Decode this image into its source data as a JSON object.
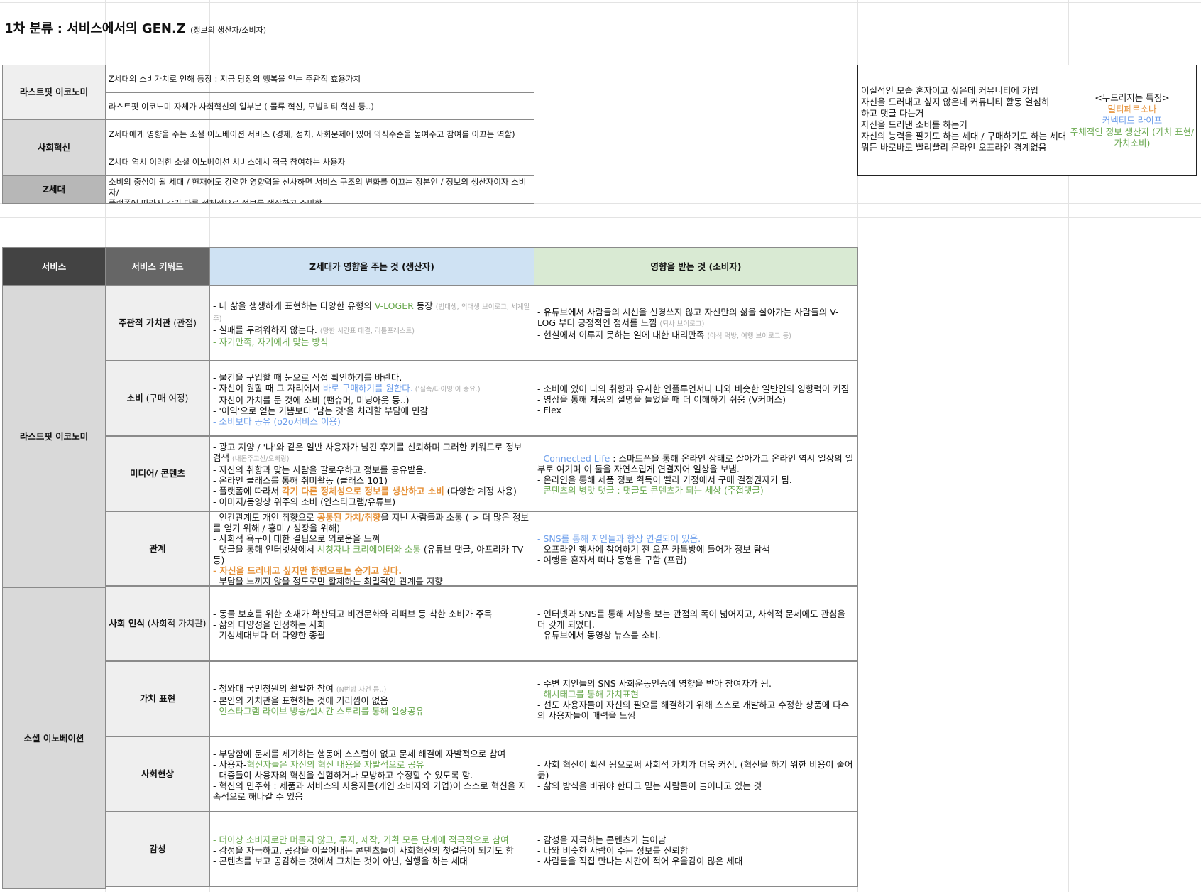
{
  "title": {
    "main": "1차 분류 : 서비스에서의 GEN.Z",
    "sub": "(정보의 생산자/소비자)"
  },
  "definitions": {
    "lastfit_label": "라스트핏 이코노미",
    "lastfit_1": "Z세대의 소비가치로 인해 등장 : 지금 당장의 행복을 얻는 주관적 효용가치",
    "lastfit_2": "라스트핏 이코노미 자체가 사회혁신의 일부분 ( 물류 혁신, 모빌리티 혁신 등..)",
    "social_label": "사회혁신",
    "social_1": "Z세대에게 영향을 주는 소셜 이노베이션 서비스 (경제, 정치, 사회문제에 있어 의식수준을 높여주고 참여를 이끄는 역할)",
    "social_2": "Z세대 역시 이러한 소셜 이노베이션 서비스에서 적극 참여하는 사용자",
    "genz_label": "Z세대",
    "genz_1": "소비의 중심이 될 세대 / 현재에도 강력한 영향력을 선사하면 서비스 구조의 변화를 이끄는 장본인 / 정보의 생산자이자 소비자/",
    "genz_2": "플랫폼에 따라서 각기 다른 정체성으로 정보를 생산하고 소비함."
  },
  "side_note": {
    "lines": [
      "이질적인 모습 혼자이고 싶은데 커뮤니티에 가입",
      "자신을 드러내고 싶지 않은데 커뮤니티 활동 열심히",
      "하고 댓글 다는거",
      "자신을 드러낸 소비를 하는거",
      "자신의 능력을 팔기도 하는 세대 / 구매하기도 하는 세대",
      "뭐든 바로바로 빨리빨리 온라인 오프라인 경계없음"
    ],
    "heading": "<두드러지는 특징>",
    "trait_1": "멀티페르소나",
    "trait_2": "커넥티드 라이프",
    "trait_3": "주체적인 정보 생산자 (가치 표현/가치소비)"
  },
  "table": {
    "headers": {
      "service": "서비스",
      "keyword": "서비스 키워드",
      "producer": "Z세대가 영향을 주는 것 (생산자)",
      "consumer": "영향을 받는 것 (소비자)"
    },
    "group_1": "라스트핏 이코노미",
    "group_2": "소셜 이노베이션",
    "rows": [
      {
        "kw_main": "주관적 가치관",
        "kw_sub": " (관점)",
        "p": [
          {
            "t": "- 내 삶을 생생하게 표현하는 다양한 유형의 ",
            "g": "V-LOGER",
            "t2": " 등장 ",
            "m": "(법대생, 의대생 브이로그, 세계일주)"
          },
          {
            "t": "- 실패를 두려워하지 않는다. ",
            "m": "(망한 시간표 대결, 리틀포레스트)"
          },
          {
            "g": "- 자기만족, 자기에게 맞는 방식"
          }
        ],
        "c": [
          {
            "t": "- 유튜브에서 사람들의 시선을 신경쓰지 않고 자신만의 삶을 살아가는 사람들의 V-LOG 부터 긍정적인 정서를 느낌 ",
            "m": "(퇴사 브이로그)"
          },
          {
            "t": "- 현실에서 이루지 못하는 일에 대한 대리만족 ",
            "m": "(야식 먹방, 여행 브이로그 등)"
          }
        ]
      },
      {
        "kw_main": "소비",
        "kw_sub": " (구매 여정)",
        "p": [
          {
            "t": "- 물건을 구입할 때 눈으로 직접 확인하기를 바란다."
          },
          {
            "t": "- 자신이 원할 때 그 자리에서 ",
            "b": "바로 구매하기를 원한다.",
            "m": " ('실속/타이밍'이 중요.)"
          },
          {
            "t": "- 자신이 가치를 둔 것에 소비 (팬슈머, 미닝아웃 등..)"
          },
          {
            "t": "- '이익'으로 얻는 기쁨보다 '남는 것'을 처리할 부담에 민감"
          },
          {
            "b": "- 소비보다 공유 (o2o서비스 이용)"
          }
        ],
        "c": [
          {
            "t": "- 소비에 있어 나의 취향과 유사한 인플루언서나 나와 비슷한 일반인의 영향력이 커짐"
          },
          {
            "t": "- 영상을 통해 제품의 설명을 들었을 때 더 이해하기 쉬움 (V커머스)"
          },
          {
            "t": "- Flex"
          }
        ]
      },
      {
        "kw_main": "미디어/ 콘텐츠",
        "kw_sub": "",
        "p": [
          {
            "t": "- 광고 지양 / '나'와 같은 일반 사용자가 남긴 후기를 신뢰하며 그러한 키워드로 정보 검색 ",
            "m": "(내돈주고산/오빠랑)"
          },
          {
            "t": "- 자신의 취향과 맞는 사람을 팔로우하고 정보를 공유받음."
          },
          {
            "t": "- 온라인 클래스를 통해 취미활동 (클래스 101)"
          },
          {
            "t": "- 플랫폼에 따라서 ",
            "o": "각기 다른 정체성으로 정보를 생산하고 소비",
            "t2": " (다양한 계정 사용)"
          },
          {
            "t": "- 이미지/동영상 위주의 소비 (인스타그램/유튜브)"
          }
        ],
        "c": [
          {
            "t": "- ",
            "b": "Connected Life",
            "t2": " : 스마트폰을 통해 온라인 상태로 살아가고 온라인 역시 일상의 일부로 여기며 이 둘을 자연스럽게 연결지어 일상을 보냄."
          },
          {
            "t": "- 온라인을 통해 제품 정보 획득이 빨라 가정에서 구매 결정권자가 됨."
          },
          {
            "g": "- 콘텐츠의 병맛 댓글 : 댓글도 콘텐츠가 되는 세상 (주접댓글)"
          }
        ]
      },
      {
        "kw_main": "관계",
        "kw_sub": "",
        "p": [
          {
            "t": "- 인간관계도 개인 취향으로 ",
            "o": "공통된 가치/취향",
            "t2": "을 지닌 사람들과 소통 (-> 더 많은 정보를 얻기 위해 / 흥미 / 성장을 위해)"
          },
          {
            "t": "- 사회적 욕구에 대한 결핍으로 외로움을 느껴"
          },
          {
            "t": "- 댓글을 통해 인터넷상에서 ",
            "g": "시청자나 크리에이터와 소통",
            "t2": " (유튜브 댓글, 아프리카 TV 등)"
          },
          {
            "o": "- 자신을 드러내고 싶지만 한편으로는 숨기고 싶다."
          },
          {
            "t": "- 부담을 느끼지 않을 정도로만 할제하는 최밀적인 관계를 지향"
          }
        ],
        "c": [
          {
            "b": "- SNS를 통해 지인들과 항상 연결되어 있음."
          },
          {
            "t": "- 오프라인 행사에 참여하기 전 오픈 카톡방에 들어가 정보 탐색"
          },
          {
            "t": "- 여행을 혼자서 떠나 동행을 구함 (프립)"
          }
        ]
      },
      {
        "kw_main": "사회 인식",
        "kw_sub": " (사회적 가치관)",
        "p": [
          {
            "t": "- 동물 보호를 위한 소재가 확산되고 비건문화와 리퍼브 등 착한 소비가 주목"
          },
          {
            "t": "- 삶의 다양성을 인정하는 사회"
          },
          {
            "t": "- 기성세대보다 더 다양한 종괄"
          }
        ],
        "c": [
          {
            "t": "- 인터넷과 SNS를 통해 세상을 보는 관점의 폭이 넓어지고, 사회적 문제에도 관심을 더 갖게 되었다."
          },
          {
            "t": "- 유튜브에서 동영상 뉴스를 소비."
          }
        ]
      },
      {
        "kw_main": "가치 표현",
        "kw_sub": "",
        "p": [
          {
            "t": "- 청와대 국민청원의 활발한 참여 ",
            "m": "(N번방 사건 등..)"
          },
          {
            "t": "- 본인의 가치관을 표현하는 것에 거리낌이 없음"
          },
          {
            "g": "- 인스타그램 라이브 방송/실시간 스토리를 통해 일상공유"
          }
        ],
        "c": [
          {
            "t": "- 주변 지인들의 SNS 사회운동인증에 영향을 받아 참여자가 됨."
          },
          {
            "g": "- 해시태그를 통해 가치표현"
          },
          {
            "t": "- 선도 사용자들이 자신의 필요를 해결하기 위해 스스로 개발하고 수정한 상품에 다수의 사용자들이 매력을 느낌"
          }
        ]
      },
      {
        "kw_main": "사회현상",
        "kw_sub": "",
        "p": [
          {
            "t": "- 부당함에 문제를 제기하는 행동에 스스럼이 없고 문제 해결에 자발적으로 참여"
          },
          {
            "t": "- 사용자-",
            "g": "혁신자들은 자신의 혁신 내용을 자발적으로 공유"
          },
          {
            "t": "- 대중들이 사용자의 혁신을 실험하거나 모방하고 수정할 수 있도록 함."
          },
          {
            "t": "- 혁신의 민주화 : 제품과 서비스의 사용자들(개인 소비자와 기업)이 스스로 혁신을 지속적으로 해나갈 수 있음"
          }
        ],
        "c": [
          {
            "t": "- 사회 혁신이 확산 됨으로써 사회적 가치가 더욱 커짐. (혁신을 하기 위한 비용이 줄어듦)"
          },
          {
            "t": "- 삶의 방식을 바꿔야 한다고 믿는 사람들이 늘어나고 있는 것"
          }
        ]
      },
      {
        "kw_main": "감성",
        "kw_sub": "",
        "p": [
          {
            "g": "- 더이상 소비자로만 머물지 않고, 투자, 제작, 기획 모든 단계에 적극적으로 참여"
          },
          {
            "t": "- 감성을 자극하고, 공감을 이끌어내는 콘텐츠들이 사회혁신의 첫걸음이 되기도 함"
          },
          {
            "t": "- 콘텐츠를 보고 공감하는 것에서 그치는 것이 아닌, 실행을 하는 세대"
          }
        ],
        "c": [
          {
            "t": "- 감성을 자극하는 콘텐츠가 늘어남"
          },
          {
            "t": "- 나와 비슷한 사람이 주는 정보를 신뢰함"
          },
          {
            "t": "- 사람들을 직접 만나는 시간이 적어 우울감이 많은 세대"
          }
        ]
      }
    ]
  }
}
